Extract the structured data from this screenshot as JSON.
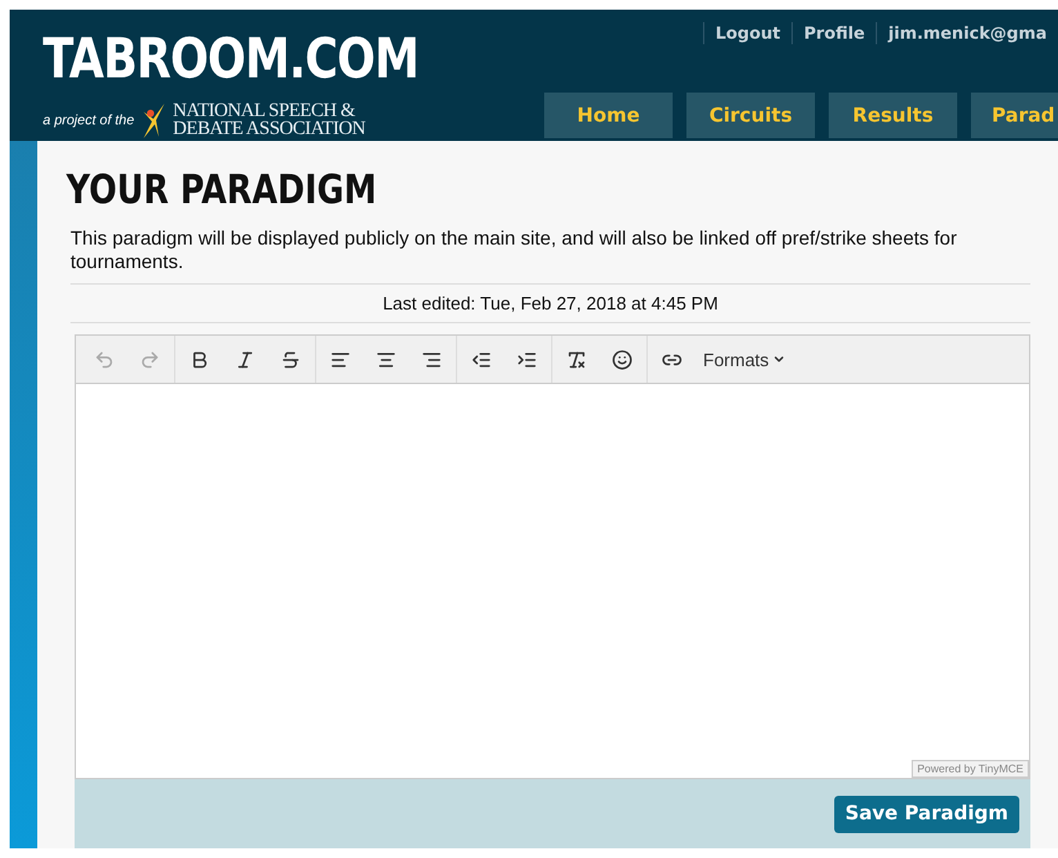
{
  "header": {
    "logo": "TABROOM.COM",
    "tagline": "a project of the",
    "org_line_1": "NATIONAL SPEECH &",
    "org_line_2": "DEBATE ASSOCIATION",
    "user_links": [
      "Logout",
      "Profile",
      "jim.menick@gma"
    ],
    "nav": [
      "Home",
      "Circuits",
      "Results",
      "Parad"
    ]
  },
  "page": {
    "title": "YOUR PARADIGM",
    "intro": "This paradigm will be displayed publicly on the main site, and will also be linked off pref/strike sheets for tournaments.",
    "last_edited": "Last edited: Tue, Feb 27, 2018 at 4:45 PM"
  },
  "editor": {
    "toolbar": [
      {
        "kind": "undo",
        "disabled": true
      },
      {
        "kind": "redo",
        "disabled": true
      },
      {
        "kind": "sep"
      },
      {
        "kind": "bold",
        "disabled": false
      },
      {
        "kind": "italic",
        "disabled": false
      },
      {
        "kind": "strike",
        "disabled": false
      },
      {
        "kind": "sep"
      },
      {
        "kind": "align-left",
        "disabled": false
      },
      {
        "kind": "align-center",
        "disabled": false
      },
      {
        "kind": "align-right",
        "disabled": false
      },
      {
        "kind": "sep"
      },
      {
        "kind": "outdent",
        "disabled": false
      },
      {
        "kind": "indent",
        "disabled": false
      },
      {
        "kind": "sep"
      },
      {
        "kind": "clear-format",
        "disabled": false
      },
      {
        "kind": "emoji",
        "disabled": false
      },
      {
        "kind": "sep"
      },
      {
        "kind": "link",
        "disabled": false
      },
      {
        "kind": "menu",
        "label": "Formats",
        "disabled": false
      }
    ],
    "branding": "Powered by TinyMCE",
    "save_label": "Save Paradigm"
  }
}
